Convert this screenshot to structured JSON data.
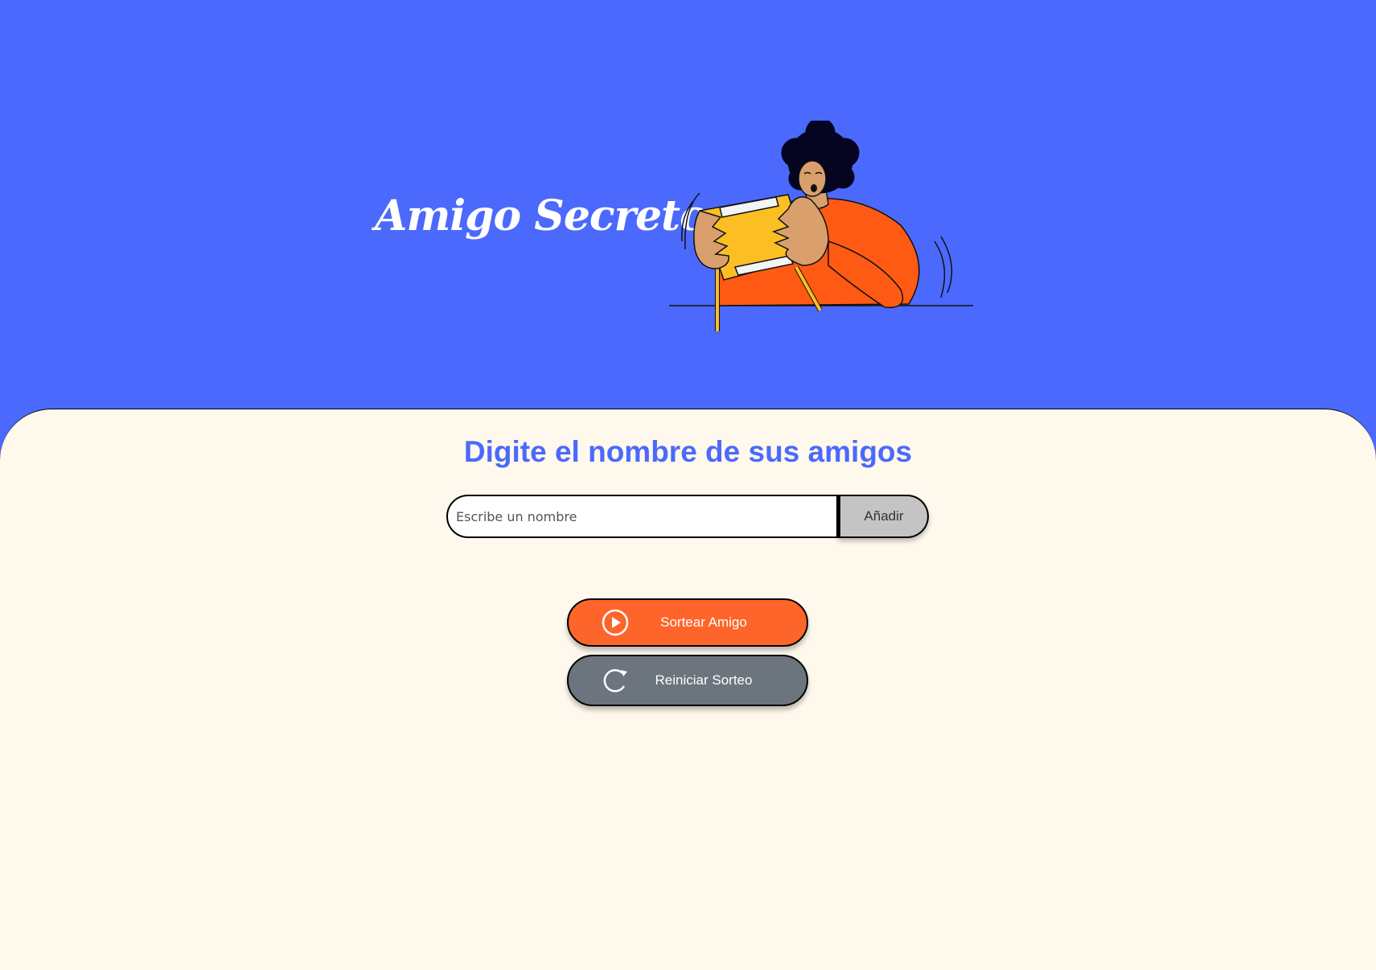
{
  "header": {
    "title": "Amigo Secreto"
  },
  "input_section": {
    "title": "Digite el nombre de sus amigos",
    "name_input": {
      "placeholder": "Escribe un nombre",
      "value": ""
    },
    "add_button_label": "Añadir"
  },
  "actions": {
    "draw_button_label": "Sortear Amigo",
    "reset_button_label": "Reiniciar Sorteo"
  },
  "colors": {
    "header_bg": "#4b69fd",
    "section_bg": "#fff8ec",
    "draw_button": "#fe652b",
    "reset_button": "#6c757d",
    "add_button": "#c4c4c4"
  },
  "icons": {
    "draw": "play-circle-icon",
    "reset": "reload-icon"
  }
}
